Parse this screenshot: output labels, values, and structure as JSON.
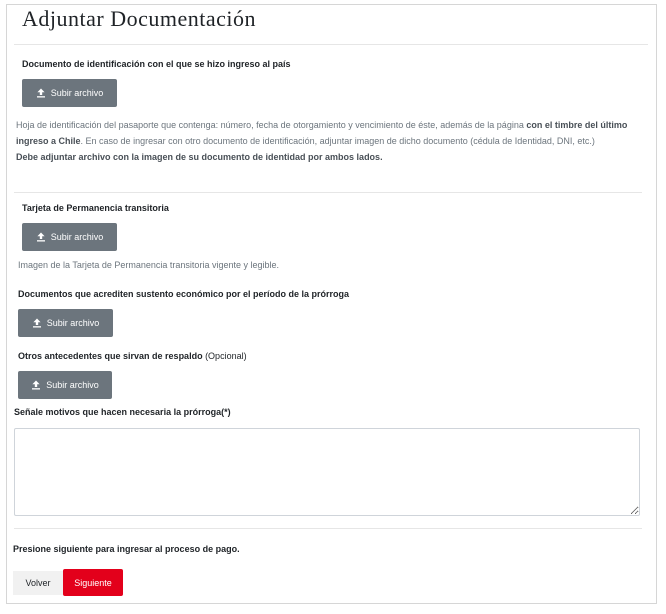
{
  "page": {
    "title": "Adjuntar Documentación"
  },
  "sections": {
    "identificacion": {
      "label": "Documento de identificación con el que se hizo ingreso al país",
      "upload_label": "Subir archivo",
      "help_part1": "Hoja de identificación del pasaporte que contenga: número, fecha de otorgamiento y vencimiento de éste, además de la página ",
      "help_bold": "con el timbre del último ingreso a Chile",
      "help_part2": ". En caso de ingresar con otro documento de identificación, adjuntar imagen de dicho documento (cédula de Identidad, DNI, etc.)",
      "help_note": "Debe adjuntar archivo con la imagen de su documento de identidad por ambos lados."
    },
    "tarjeta": {
      "label": "Tarjeta de Permanencia transitoria",
      "upload_label": "Subir archivo",
      "help": "Imagen de la Tarjeta de Permanencia transitoria vigente y legible."
    },
    "sustento": {
      "label": "Documentos que acrediten sustento económico por el período de la prórroga",
      "upload_label": "Subir archivo"
    },
    "otros": {
      "label": "Otros antecedentes que sirvan de respaldo",
      "optional": " (Opcional)",
      "upload_label": "Subir archivo"
    },
    "motivos": {
      "label": "Señale motivos que hacen necesaria la prórroga(*)",
      "value": ""
    }
  },
  "footer": {
    "instruction": "Presione siguiente para ingresar al proceso de pago.",
    "back_label": "Volver",
    "next_label": "Siguiente"
  },
  "colors": {
    "upload_button": "#6c757d",
    "next_button": "#e3001b"
  },
  "icons": {
    "upload": "upload-icon"
  }
}
